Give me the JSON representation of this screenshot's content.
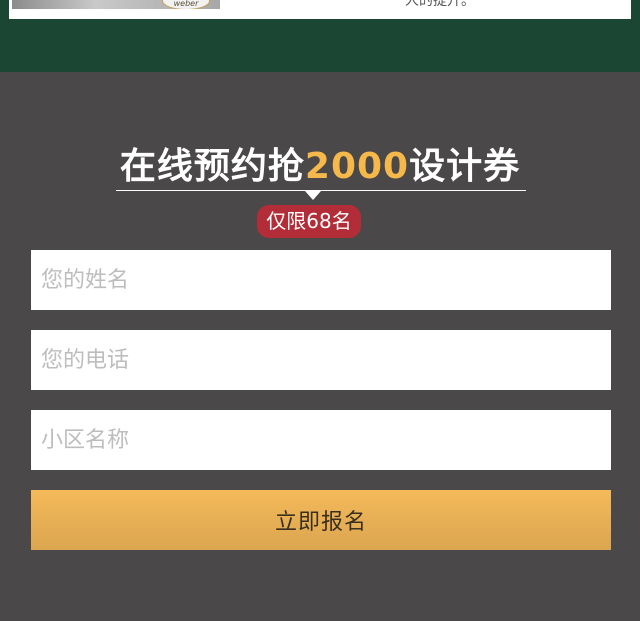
{
  "top": {
    "thumb_logo": "weber",
    "text": "人的提升。"
  },
  "form": {
    "headline_before": "在线预约抢",
    "headline_highlight": "2000",
    "headline_after": "设计券",
    "limit_badge": "仅限68名",
    "name_placeholder": "您的姓名",
    "phone_placeholder": "您的电话",
    "community_placeholder": "小区名称",
    "submit_label": "立即报名"
  },
  "colors": {
    "background": "#4a4848",
    "top_band": "#1b4634",
    "highlight": "#f6b84b",
    "badge": "#b22d37",
    "button": "#e9b055"
  }
}
